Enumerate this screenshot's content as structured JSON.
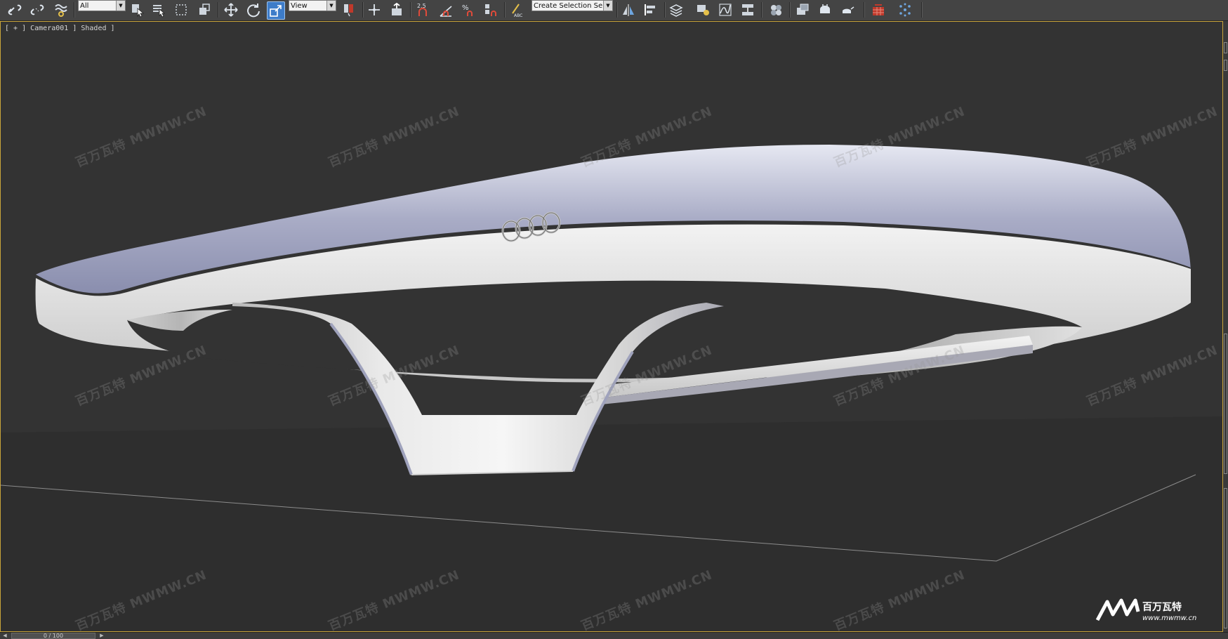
{
  "toolbar": {
    "selection_filter": "All",
    "reference_coord": "View",
    "snap_angle": "2.5",
    "named_selection": "Create Selection Se",
    "icons": [
      "link-icon",
      "unlink-icon",
      "bind-spacewarp-icon",
      "select-object-icon",
      "select-by-name-icon",
      "rect-region-icon",
      "window-crossing-icon",
      "move-icon",
      "rotate-icon",
      "scale-icon",
      "select-manipulate-icon",
      "pivot-icon",
      "keyboard-shortcut-icon",
      "snaps-toggle-icon",
      "angle-snap-icon",
      "percent-snap-icon",
      "spinner-snap-icon",
      "edit-named-selection-icon",
      "mirror-icon",
      "align-icon",
      "layer-explorer-icon",
      "toggle-ribbon-icon",
      "curve-editor-icon",
      "schematic-view-icon",
      "material-editor-icon",
      "render-setup-icon",
      "rendered-frame-icon",
      "render-icon",
      "render-online-icon",
      "particle-icon"
    ]
  },
  "viewport": {
    "label": "[ + ] Camera001 ] Shaded ]",
    "border_color": "#c8a43a",
    "background_color": "#333333",
    "object": {
      "logo": "four-rings-emblem"
    }
  },
  "watermark": {
    "text": "MWMW.CN",
    "cn_text": "百万瓦特"
  },
  "brand_logo": {
    "cn_text": "百万瓦特",
    "url_text": "www.mwmw.cn"
  },
  "statusbar": {
    "frame_counter": "0 / 100"
  }
}
